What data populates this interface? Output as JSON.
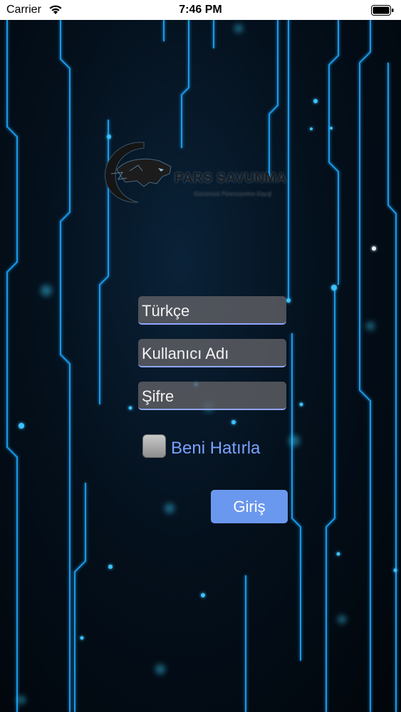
{
  "status_bar": {
    "carrier": "Carrier",
    "time": "7:46 PM"
  },
  "logo": {
    "name": "PARS SAVUNMA",
    "slogan": "Gücünüzü Potansiyeline Kaçığ"
  },
  "form": {
    "language": {
      "value": "Türkçe"
    },
    "username": {
      "placeholder": "Kullanıcı Adı"
    },
    "password": {
      "placeholder": "Şifre"
    },
    "remember_label": "Beni Hatırla",
    "login_label": "Giriş"
  },
  "colors": {
    "accent_blue": "#6a98ee",
    "label_blue": "#7aa2ff",
    "circuit_glow": "#1aa8ff"
  }
}
